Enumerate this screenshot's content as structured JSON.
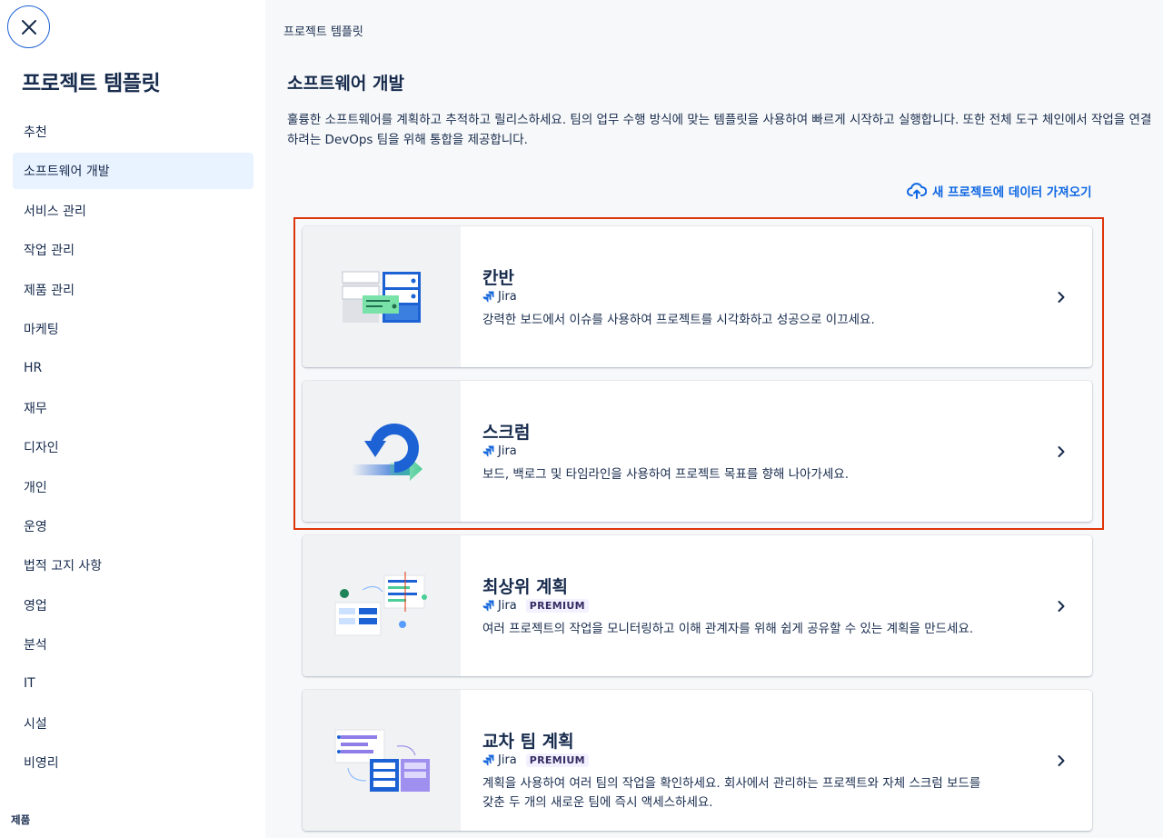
{
  "sidebar": {
    "title": "프로젝트 템플릿",
    "items": [
      {
        "label": "추천"
      },
      {
        "label": "소프트웨어 개발"
      },
      {
        "label": "서비스 관리"
      },
      {
        "label": "작업 관리"
      },
      {
        "label": "제품 관리"
      },
      {
        "label": "마케팅"
      },
      {
        "label": "HR"
      },
      {
        "label": "재무"
      },
      {
        "label": "디자인"
      },
      {
        "label": "개인"
      },
      {
        "label": "운영"
      },
      {
        "label": "법적 고지 사항"
      },
      {
        "label": "영업"
      },
      {
        "label": "분석"
      },
      {
        "label": "IT"
      },
      {
        "label": "시설"
      },
      {
        "label": "비영리"
      }
    ],
    "active_index": 1,
    "section_label": "제품"
  },
  "main": {
    "breadcrumb": "프로젝트 템플릿",
    "title": "소프트웨어 개발",
    "description": "훌륭한 소프트웨어를 계획하고 추적하고 릴리스하세요. 팀의 업무 수행 방식에 맞는 템플릿을 사용하여 빠르게 시작하고 실행합니다. 또한 전체 도구 체인에서 작업을 연결하려는 DevOps 팀을 위해 통합을 제공합니다.",
    "import_link": "새 프로젝트에 데이터 가져오기"
  },
  "templates": [
    {
      "title": "칸반",
      "product": "Jira",
      "badge": "",
      "description": "강력한 보드에서 이슈를 사용하여 프로젝트를 시각화하고 성공으로 이끄세요."
    },
    {
      "title": "스크럼",
      "product": "Jira",
      "badge": "",
      "description": "보드, 백로그 및 타임라인을 사용하여 프로젝트 목표를 향해 나아가세요."
    },
    {
      "title": "최상위 계획",
      "product": "Jira",
      "badge": "PREMIUM",
      "description": "여러 프로젝트의 작업을 모니터링하고 이해 관계자를 위해 쉽게 공유할 수 있는 계획을 만드세요."
    },
    {
      "title": "교차 팀 계획",
      "product": "Jira",
      "badge": "PREMIUM",
      "description": "계획을 사용하여 여러 팀의 작업을 확인하세요. 회사에서 관리하는 프로젝트와 자체 스크럼 보드를 갖춘 두 개의 새로운 팀에 즉시 액세스하세요."
    }
  ],
  "colors": {
    "accent": "#0c66e4",
    "highlight": "#de350b",
    "active_nav": "#e9f2ff"
  }
}
